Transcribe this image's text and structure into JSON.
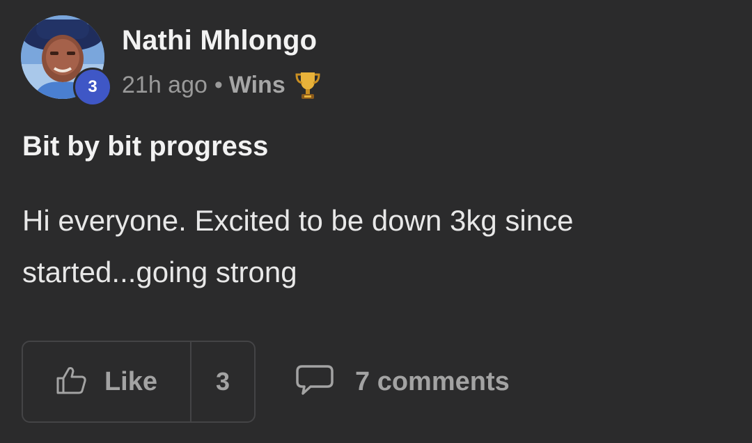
{
  "post": {
    "author": {
      "name": "Nathi Mhlongo",
      "level": "3"
    },
    "meta": {
      "time": "21h ago",
      "separator": "•",
      "category": "Wins",
      "category_icon": "trophy-icon"
    },
    "title": "Bit by bit progress",
    "body": "Hi everyone. Excited to be down 3kg since started...going strong",
    "actions": {
      "like_label": "Like",
      "like_icon": "thumbs-up-icon",
      "like_count": "3",
      "comments_label": "7 comments",
      "comments_icon": "comment-icon"
    }
  },
  "colors": {
    "background": "#2b2b2c",
    "level_badge": "#3f57c6",
    "muted_text": "#a3a3a3",
    "border": "#444446"
  }
}
